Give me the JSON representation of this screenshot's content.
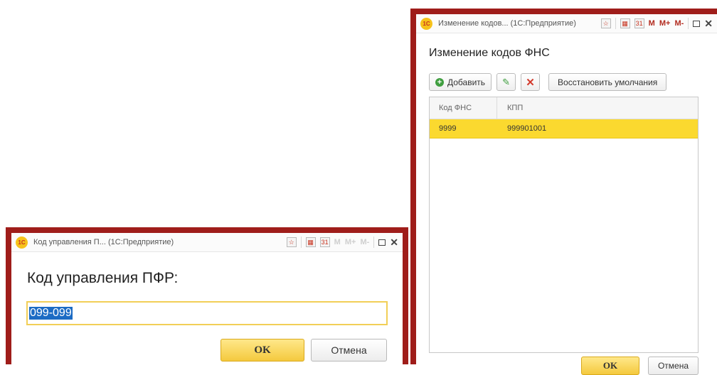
{
  "pfr_dialog": {
    "window_title": "Код управления П... (1С:Предприятие)",
    "heading": "Код управления ПФР:",
    "field_value": "099-099",
    "ok_label": "OK",
    "cancel_label": "Отмена"
  },
  "fns_dialog": {
    "window_title": "Изменение кодов... (1С:Предприятие)",
    "heading": "Изменение кодов ФНС",
    "toolbar": {
      "add_label": "Добавить",
      "restore_label": "Восстановить умолчания"
    },
    "table": {
      "columns": [
        "Код ФНС",
        "КПП"
      ],
      "rows": [
        {
          "code": "9999",
          "kpp": "999901001"
        }
      ]
    },
    "ok_label": "OK",
    "cancel_label": "Отмена"
  },
  "titlebar_buttons": {
    "m": "M",
    "m_plus": "M+",
    "m_minus": "M-"
  },
  "colors": {
    "frame": "#9f1d1a",
    "accent_yellow": "#fbd92f",
    "selection": "#1c6bc4"
  },
  "icons": [
    "1c-logo-icon",
    "favorite-icon",
    "calculator-icon",
    "calendar-icon",
    "maximize-icon",
    "close-icon",
    "add-icon",
    "edit-icon",
    "delete-icon"
  ]
}
